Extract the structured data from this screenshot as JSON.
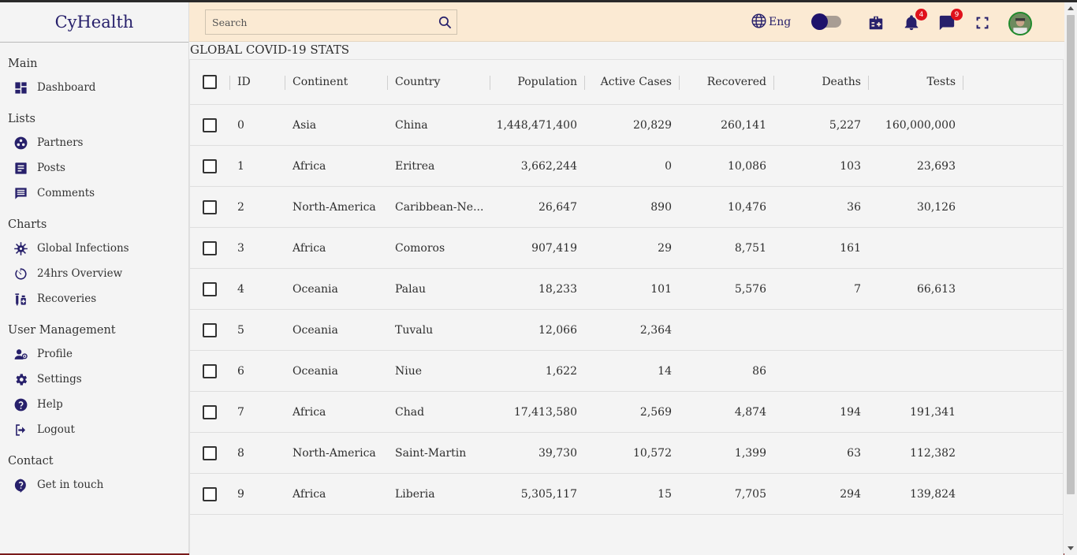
{
  "app": {
    "logo": "CyHealth"
  },
  "sidebar": {
    "sections": [
      {
        "title": "Main",
        "items": [
          {
            "label": "Dashboard",
            "icon": "dashboard-icon"
          }
        ]
      },
      {
        "title": "Lists",
        "items": [
          {
            "label": "Partners",
            "icon": "partners-icon"
          },
          {
            "label": "Posts",
            "icon": "posts-icon"
          },
          {
            "label": "Comments",
            "icon": "comments-icon"
          }
        ]
      },
      {
        "title": "Charts",
        "items": [
          {
            "label": "Global Infections",
            "icon": "virus-icon"
          },
          {
            "label": "24hrs Overview",
            "icon": "timer-icon"
          },
          {
            "label": "Recoveries",
            "icon": "vaccine-icon"
          }
        ]
      },
      {
        "title": "User Management",
        "items": [
          {
            "label": "Profile",
            "icon": "profile-icon"
          },
          {
            "label": "Settings",
            "icon": "settings-icon"
          },
          {
            "label": "Help",
            "icon": "help-icon"
          },
          {
            "label": "Logout",
            "icon": "logout-icon"
          }
        ]
      },
      {
        "title": "Contact",
        "items": [
          {
            "label": "Get in touch",
            "icon": "contact-help-icon"
          }
        ]
      }
    ]
  },
  "topbar": {
    "search_placeholder": "Search",
    "language": "Eng",
    "notifications_count": "4",
    "messages_count": "9",
    "accent_color": "#27206b",
    "bar_color": "#fbead3"
  },
  "main": {
    "title": "GLOBAL COVID-19 STATS",
    "columns": [
      "ID",
      "Continent",
      "Country",
      "Population",
      "Active Cases",
      "Recovered",
      "Deaths",
      "Tests"
    ],
    "rows": [
      [
        "0",
        "Asia",
        "China",
        "1,448,471,400",
        "20,829",
        "260,141",
        "5,227",
        "160,000,000"
      ],
      [
        "1",
        "Africa",
        "Eritrea",
        "3,662,244",
        "0",
        "10,086",
        "103",
        "23,693"
      ],
      [
        "2",
        "North-America",
        "Caribbean-Ne...",
        "26,647",
        "890",
        "10,476",
        "36",
        "30,126"
      ],
      [
        "3",
        "Africa",
        "Comoros",
        "907,419",
        "29",
        "8,751",
        "161",
        ""
      ],
      [
        "4",
        "Oceania",
        "Palau",
        "18,233",
        "101",
        "5,576",
        "7",
        "66,613"
      ],
      [
        "5",
        "Oceania",
        "Tuvalu",
        "12,066",
        "2,364",
        "",
        "",
        ""
      ],
      [
        "6",
        "Oceania",
        "Niue",
        "1,622",
        "14",
        "86",
        "",
        ""
      ],
      [
        "7",
        "Africa",
        "Chad",
        "17,413,580",
        "2,569",
        "4,874",
        "194",
        "191,341"
      ],
      [
        "8",
        "North-America",
        "Saint-Martin",
        "39,730",
        "10,572",
        "1,399",
        "63",
        "112,382"
      ],
      [
        "9",
        "Africa",
        "Liberia",
        "5,305,117",
        "15",
        "7,705",
        "294",
        "139,824"
      ]
    ]
  }
}
